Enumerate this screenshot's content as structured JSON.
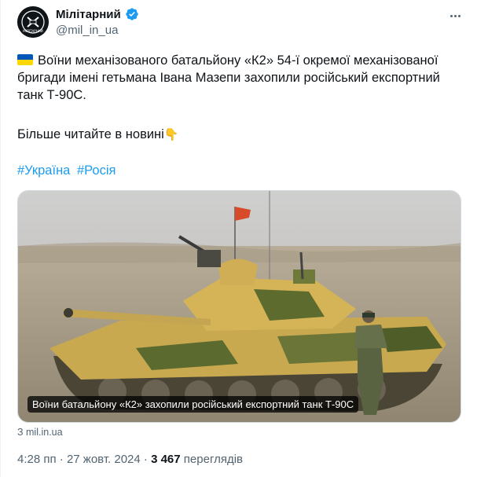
{
  "author": {
    "display_name": "Мілітарний",
    "handle": "@mil_in_ua",
    "verified": true,
    "avatar_icon": "militarnyi-logo"
  },
  "tweet": {
    "flag_icon": "ukraine-flag-emoji",
    "text_main": "Воїни механізованого батальйону «К2» 54-ї окремої механізованої бригади імені гетьмана Івана Мазепи захопили російський експортний танк Т-90С.",
    "text_more": "Більше читайте в новині",
    "more_emoji": "👇",
    "hashtags": [
      "#Україна",
      "#Росія"
    ]
  },
  "media": {
    "caption": "Воїни батальйону «К2» захопили російський експортний танк Т-90С",
    "source": "З mil.in.ua"
  },
  "meta": {
    "time": "4:28 пп",
    "separator": "·",
    "date": "27 жовт. 2024",
    "views_count": "3 467",
    "views_label": "переглядів"
  },
  "colors": {
    "accent": "#1d9bf0",
    "secondary_text": "#536471",
    "flag_blue": "#0057b7",
    "flag_yellow": "#ffd700"
  }
}
